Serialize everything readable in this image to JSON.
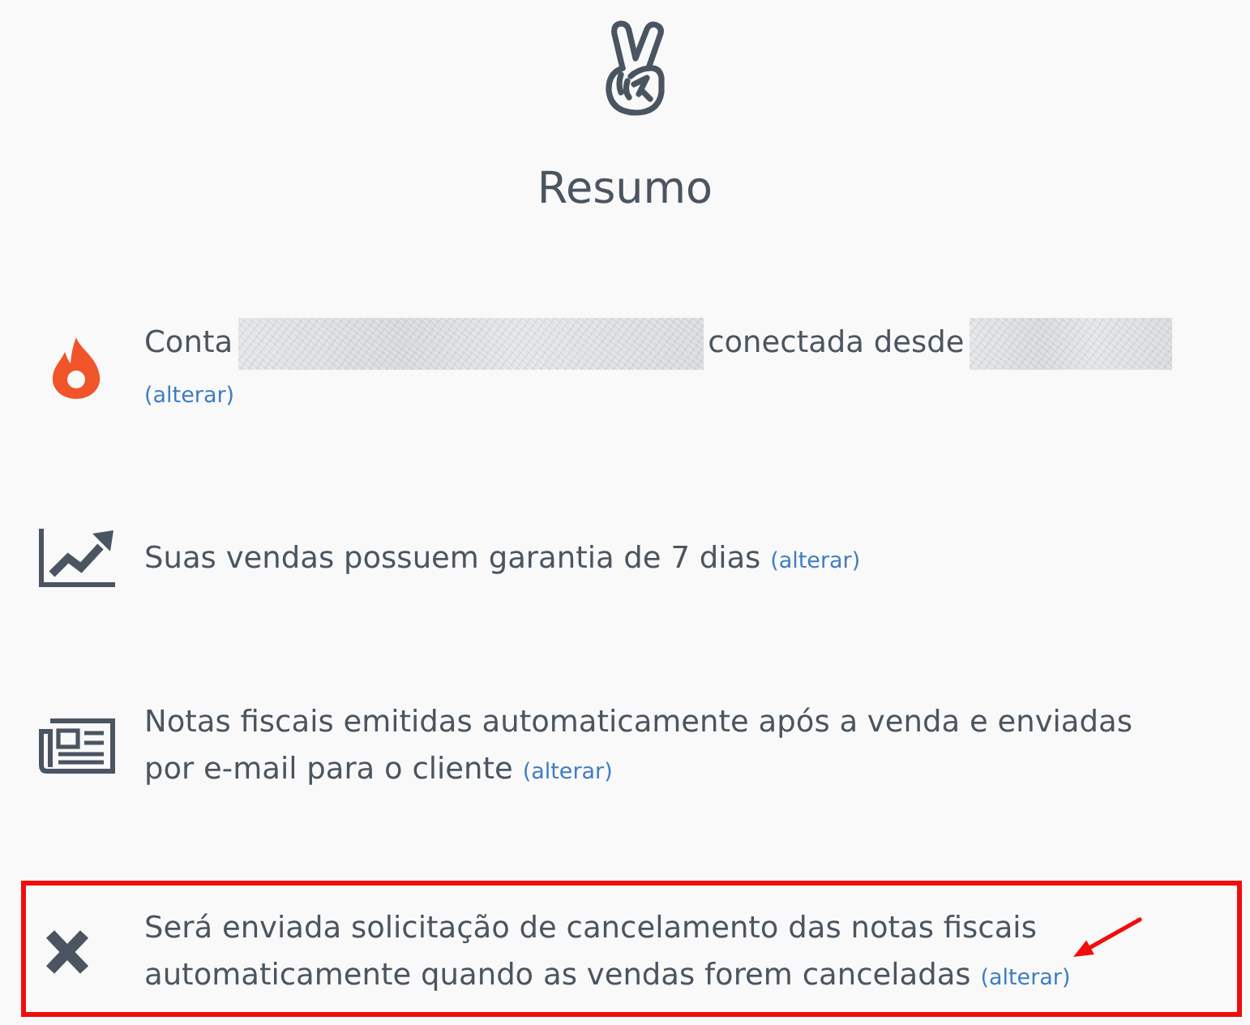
{
  "header": {
    "title": "Resumo"
  },
  "items": [
    {
      "segments": [
        {
          "kind": "text",
          "text": "Conta"
        },
        {
          "kind": "blurred"
        },
        {
          "kind": "text",
          "text": "conectada desde"
        },
        {
          "kind": "blurred"
        }
      ],
      "link": "(alterar)",
      "annotated": false
    },
    {
      "segments": [
        {
          "kind": "text",
          "text": "Suas vendas possuem garantia de 7 dias"
        }
      ],
      "link": "(alterar)",
      "annotated": false
    },
    {
      "segments": [
        {
          "kind": "text",
          "text": "Notas fiscais emitidas automaticamente após a venda e enviadas por e-mail para o cliente"
        }
      ],
      "link": "(alterar)",
      "annotated": false
    },
    {
      "segments": [
        {
          "kind": "text",
          "text": "Será enviada solicitação de cancelamento das notas fiscais automaticamente quando as vendas forem canceladas"
        }
      ],
      "link": "(alterar)",
      "annotated": true
    }
  ]
}
